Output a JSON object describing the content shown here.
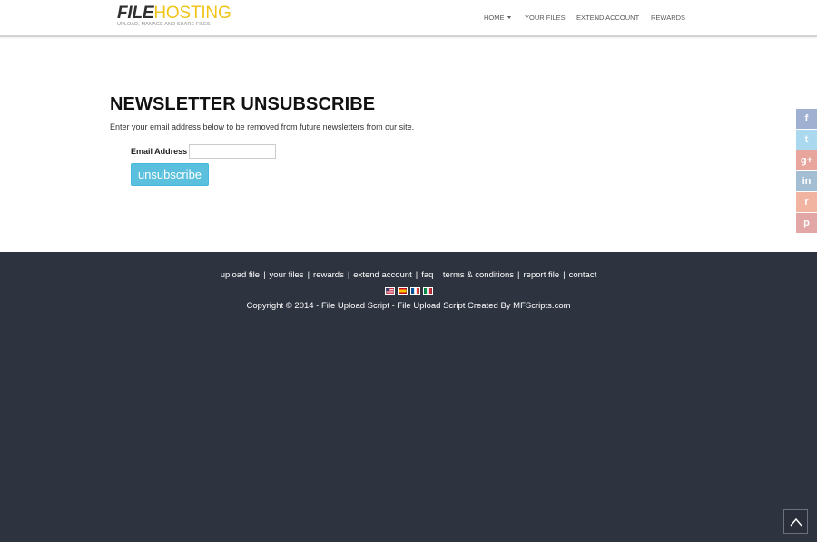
{
  "logo": {
    "file": "FILE",
    "hosting": "HOSTING",
    "tagline": "UPLOAD, MANAGE AND SHARE FILES"
  },
  "nav": {
    "home": "HOME",
    "your_files": "YOUR FILES",
    "extend_account": "EXTEND ACCOUNT",
    "rewards": "REWARDS"
  },
  "main": {
    "title": "NEWSLETTER UNSUBSCRIBE",
    "intro": "Enter your email address below to be removed from future newsletters from our site.",
    "email_label": "Email Address",
    "email_value": "",
    "button_label": "unsubscribe"
  },
  "social": [
    {
      "name": "facebook",
      "icon": "facebook-icon",
      "glyph": "f",
      "color": "#9fb0d0"
    },
    {
      "name": "twitter",
      "icon": "twitter-icon",
      "glyph": "t",
      "color": "#a9d8ef"
    },
    {
      "name": "google-plus",
      "icon": "google-plus-icon",
      "glyph": "g+",
      "color": "#e7a59c"
    },
    {
      "name": "linkedin",
      "icon": "linkedin-icon",
      "glyph": "in",
      "color": "#a3bdd2"
    },
    {
      "name": "reddit",
      "icon": "reddit-icon",
      "glyph": "r",
      "color": "#f0b4a1"
    },
    {
      "name": "pinterest",
      "icon": "pinterest-icon",
      "glyph": "p",
      "color": "#e3a6a6"
    }
  ],
  "footer": {
    "links": [
      "upload file",
      "your files",
      "rewards",
      "extend account",
      "faq",
      "terms & conditions",
      "report file",
      "contact"
    ],
    "separator": "|",
    "copyright": "Copyright © 2014 - File Upload Script - File Upload Script Created By MFScripts.com"
  },
  "colors": {
    "accent": "#f0c419",
    "button": "#5bc0de",
    "footer_bg": "#2e3340"
  }
}
